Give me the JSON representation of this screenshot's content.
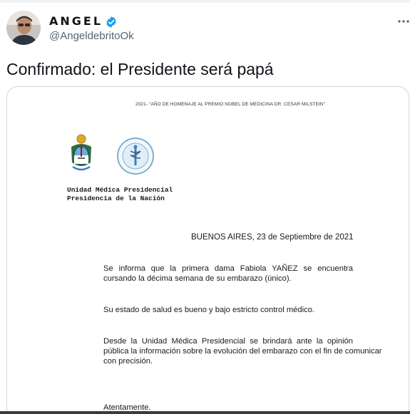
{
  "author": {
    "display_name": "ANGEL",
    "handle": "@AngeldebritoOk",
    "verified": true,
    "avatar_icon": "avatar-photo"
  },
  "tweet": {
    "text": "Confirmado: el Presidente será papá",
    "more_icon": "more-horizontal-icon"
  },
  "document": {
    "header": "2021- \"AÑO DE HOMENAJE AL PREMIO NOBEL DE MEDICINA DR. CESAR MILSTEIN\"",
    "unit_line1": "Unidad Médica Presidencial",
    "unit_line2": "Presidencia de la Nación",
    "date": "BUENOS AIRES, 23 de Septiembre de 2021",
    "para1_line1": "Se informa que la primera dama Fabiola YAÑEZ se encuentra",
    "para1_line2": "cursando la décima semana de su embarazo (único).",
    "para2": "Su estado de salud es bueno y bajo estricto control médico.",
    "para3_line1": "Desde la Unidad Médica Presidencial se brindará ante la opinión",
    "para3_line2": "pública la información sobre la evolución del embarazo con el fin de comunicar",
    "para3_line3": "con precisión.",
    "closing": "Atentamente."
  },
  "colors": {
    "verified_blue": "#1d9bf0",
    "secondary_text": "#536471",
    "border": "#cfd9de"
  }
}
